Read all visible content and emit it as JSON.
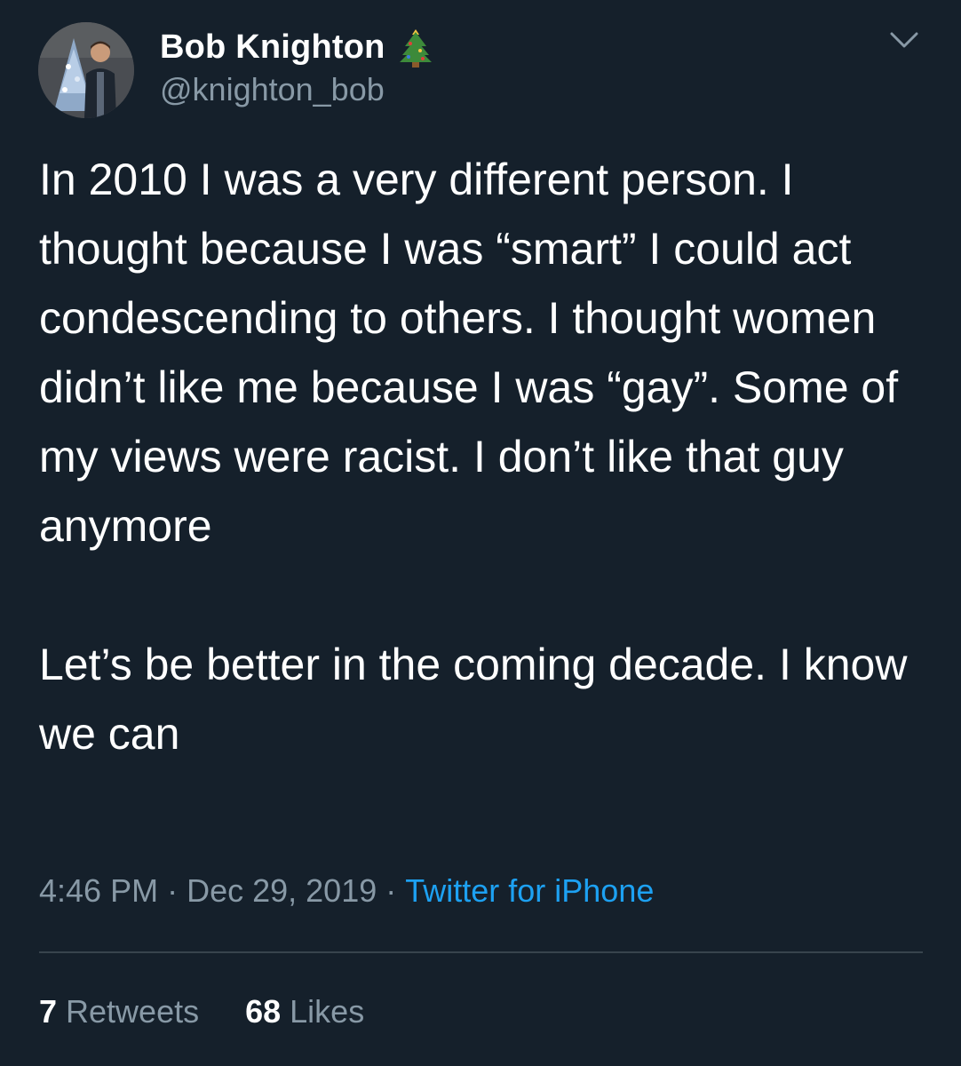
{
  "user": {
    "display_name": "Bob Knighton",
    "name_emoji": "christmas-tree",
    "handle": "@knighton_bob",
    "avatar_icon": "user-photo"
  },
  "tweet": {
    "paragraph_1": "In 2010 I was a very different person. I thought because I was “smart” I could act condescending to others. I thought women didn’t like me because I was “gay”. Some of my views were racist. I don’t like that guy anymore",
    "paragraph_2": "Let’s be better in the coming decade. I know we can"
  },
  "meta": {
    "time": "4:46 PM",
    "separator": "·",
    "date": "Dec 29, 2019",
    "source": "Twitter for iPhone"
  },
  "stats": {
    "retweets_count": "7",
    "retweets_label": "Retweets",
    "likes_count": "68",
    "likes_label": "Likes"
  },
  "colors": {
    "background": "#15202b",
    "text": "#ffffff",
    "secondary_text": "#8899a6",
    "link": "#1da1f2",
    "divider": "#38444d"
  },
  "icons": {
    "menu": "chevron-down-icon"
  }
}
